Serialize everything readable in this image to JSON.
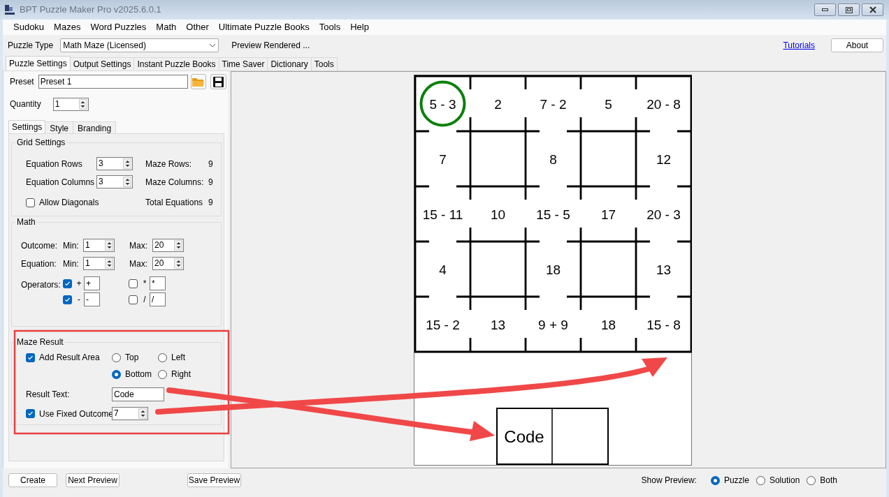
{
  "window": {
    "title": "BPT Puzzle Maker Pro v2025.6.0.1"
  },
  "menu": [
    "Sudoku",
    "Mazes",
    "Word Puzzles",
    "Math",
    "Other",
    "Ultimate Puzzle Books",
    "Tools",
    "Help"
  ],
  "toolbar": {
    "puzzle_type_label": "Puzzle Type",
    "puzzle_type": "Math Maze (Licensed)",
    "status": "Preview Rendered ...",
    "link": "Tutorials",
    "about_button": "About"
  },
  "tabs": [
    {
      "label": "Puzzle Settings",
      "selected": true
    },
    {
      "label": "Output Settings",
      "selected": false
    },
    {
      "label": "Instant Puzzle Books",
      "selected": false
    },
    {
      "label": "Time Saver",
      "selected": false
    },
    {
      "label": "Dictionary",
      "selected": false
    },
    {
      "label": "Tools",
      "selected": false
    }
  ],
  "preset": {
    "label": "Preset",
    "value": "Preset 1"
  },
  "quantity": {
    "label": "Quantity",
    "value": "1"
  },
  "sub_tabs": [
    {
      "label": "Settings",
      "selected": true
    },
    {
      "label": "Style",
      "selected": false
    },
    {
      "label": "Branding",
      "selected": false
    }
  ],
  "grid_settings": {
    "title": "Grid Settings",
    "equation_rows": {
      "label": "Equation Rows",
      "value": "3"
    },
    "equation_columns": {
      "label": "Equation Columns",
      "value": "3"
    },
    "allow_diagonals": {
      "label": "Allow Diagonals",
      "checked": false
    },
    "maze_rows": {
      "label": "Maze Rows:",
      "value": "9"
    },
    "maze_columns": {
      "label": "Maze Columns:",
      "value": "9"
    },
    "total_equations": {
      "label": "Total Equations",
      "value": "9"
    }
  },
  "math": {
    "title": "Math",
    "rows": [
      {
        "label": "Outcome:",
        "min_label": "Min:",
        "min": "1",
        "max_label": "Max:",
        "max": "20"
      },
      {
        "label": "Equation:",
        "min_label": "Min:",
        "min": "1",
        "max_label": "Max:",
        "max": "20"
      }
    ],
    "operators_label": "Operators:",
    "operators": [
      {
        "label": "+",
        "checked": true,
        "value": "+"
      },
      {
        "label": "*",
        "checked": false,
        "value": "*"
      },
      {
        "label": "-",
        "checked": true,
        "value": "-"
      },
      {
        "label": "/",
        "checked": false,
        "value": "/"
      }
    ]
  },
  "maze_result": {
    "title": "Maze Result",
    "add_result_area": {
      "label": "Add Result Area",
      "checked": true
    },
    "positions": [
      {
        "label": "Top",
        "selected": false
      },
      {
        "label": "Left",
        "selected": false
      },
      {
        "label": "Bottom",
        "selected": true
      },
      {
        "label": "Right",
        "selected": false
      }
    ],
    "result_text": {
      "label": "Result Text:",
      "value": "Code"
    },
    "fixed_outcome": {
      "label": "Use Fixed Outcome",
      "checked": true,
      "value": "7"
    }
  },
  "buttons": [
    "Create",
    "Next Preview",
    "Save Preview"
  ],
  "show_preview": {
    "label": "Show Preview:",
    "options": [
      {
        "label": "Puzzle",
        "selected": true
      },
      {
        "label": "Solution",
        "selected": false
      },
      {
        "label": "Both",
        "selected": false
      }
    ]
  },
  "maze": {
    "rows": [
      [
        {
          "text": "5 - 3",
          "circled": true
        },
        {
          "text": "2",
          "circled": false
        },
        {
          "text": "7 - 2",
          "circled": false
        },
        {
          "text": "5",
          "circled": false
        },
        {
          "text": "20 - 8",
          "circled": false
        }
      ],
      [
        {
          "text": "7",
          "circled": false
        },
        {
          "text": "8",
          "circled": false
        },
        {
          "text": "12",
          "circled": false
        }
      ],
      [
        {
          "text": "15 - 11",
          "circled": false
        },
        {
          "text": "10",
          "circled": false
        },
        {
          "text": "15 - 5",
          "circled": false
        },
        {
          "text": "17",
          "circled": false
        },
        {
          "text": "20 - 3",
          "circled": false
        }
      ],
      [
        {
          "text": "4",
          "circled": false
        },
        {
          "text": "18",
          "circled": false
        },
        {
          "text": "13",
          "circled": false
        }
      ],
      [
        {
          "text": "15 - 2",
          "circled": false
        },
        {
          "text": "13",
          "circled": false
        },
        {
          "text": "9 + 9",
          "circled": false
        },
        {
          "text": "18",
          "circled": false
        },
        {
          "text": "15 - 8",
          "circled": false
        }
      ]
    ],
    "result_label": "Code"
  }
}
